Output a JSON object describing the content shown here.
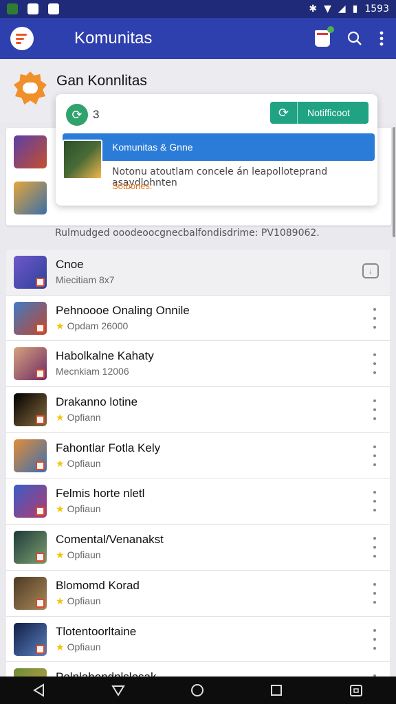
{
  "status_bar": {
    "time": "1593",
    "left_icons": [
      "app-notification-icon",
      "app-notification-icon",
      "app-notification-icon"
    ],
    "right_icons": [
      "bluetooth-icon",
      "wifi-icon",
      "signal-icon",
      "battery-icon"
    ]
  },
  "appbar": {
    "title": "Komunitas",
    "icons": [
      "app-logo-icon",
      "shop-icon",
      "search-icon",
      "more-vert-icon"
    ]
  },
  "group": {
    "name": "Gan Konnlitas"
  },
  "background_rows": {
    "member_note": "Rulmudged ooodeoocgnecbalfondisdrime: PV1089062."
  },
  "popup": {
    "count": "3",
    "notification_button": "Notifficoot",
    "selected_row": "Komunitas & Gnne",
    "description": "Notonu atoutlam concele án leapolloteprand asaydlohnten",
    "link": "Sotbones:"
  },
  "list": {
    "items": [
      {
        "title": "Cnoe",
        "subtitle": "Miecitiam 8x7",
        "rating": false,
        "action": "download",
        "selected": true,
        "colors": [
          "#6f59c9",
          "#2e3f9a"
        ]
      },
      {
        "title": "Pehnoooe Onaling Onnile",
        "subtitle": "Opdam 26000",
        "rating": true,
        "action": "more",
        "selected": false,
        "colors": [
          "#3f7cc4",
          "#c0462e"
        ]
      },
      {
        "title": "Habolkalne Kahaty",
        "subtitle": "Mecnkiam 12006",
        "rating": false,
        "action": "more",
        "selected": false,
        "colors": [
          "#d5a27c",
          "#6e2a66"
        ]
      },
      {
        "title": "Drakanno lotine",
        "subtitle": "Opfiann",
        "rating": true,
        "action": "more",
        "selected": false,
        "colors": [
          "#000000",
          "#8a6a3e"
        ]
      },
      {
        "title": "Fahontlar Fotla Kely",
        "subtitle": "Opfiaun",
        "rating": true,
        "action": "more",
        "selected": false,
        "colors": [
          "#e28d38",
          "#3b6fb2"
        ]
      },
      {
        "title": "Felmis horte nletl",
        "subtitle": "Opfiaun",
        "rating": true,
        "action": "more",
        "selected": false,
        "colors": [
          "#3a5cc7",
          "#b23b6f"
        ]
      },
      {
        "title": "Comental/Venanakst",
        "subtitle": "Opfiaun",
        "rating": true,
        "action": "more",
        "selected": false,
        "colors": [
          "#1c3a3a",
          "#7ea070"
        ]
      },
      {
        "title": "Blomomd Korad",
        "subtitle": "Opfiaun",
        "rating": true,
        "action": "more",
        "selected": false,
        "colors": [
          "#4d3a24",
          "#a88858"
        ]
      },
      {
        "title": "Tlotentoorltaine",
        "subtitle": "Opfiaun",
        "rating": true,
        "action": "more",
        "selected": false,
        "colors": [
          "#0f1f44",
          "#5c7fbf"
        ]
      },
      {
        "title": "Polnlabondnlslosak",
        "subtitle": "",
        "rating": false,
        "action": "more",
        "selected": false,
        "colors": [
          "#6b8c3a",
          "#c9a244"
        ]
      }
    ]
  },
  "navbar": {
    "icons": [
      "back-icon",
      "down-icon",
      "home-icon",
      "recents-icon",
      "screenshot-icon"
    ]
  }
}
